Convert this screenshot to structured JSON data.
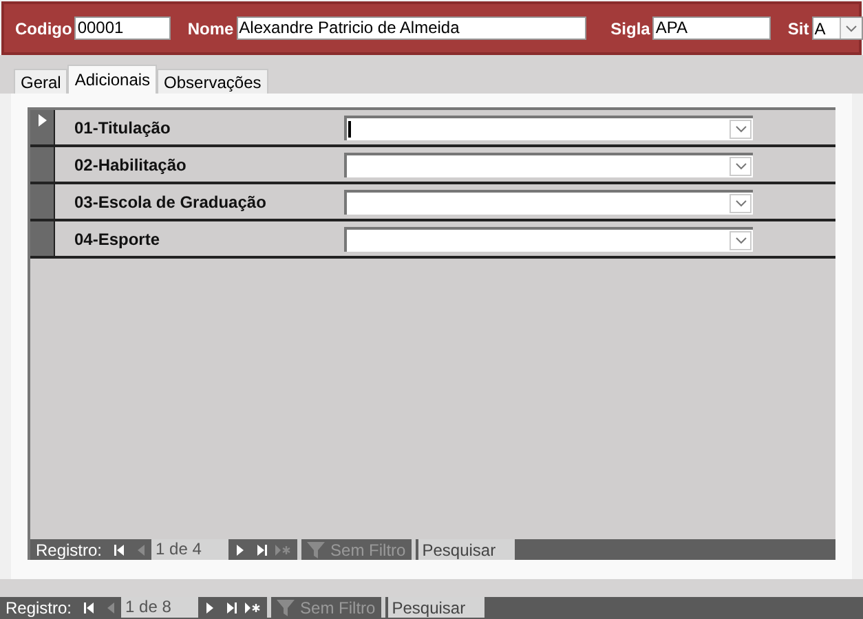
{
  "header": {
    "fields": [
      {
        "kind": "text",
        "label": "Codigo",
        "value": "00001"
      },
      {
        "kind": "text",
        "label": "Nome",
        "value": "Alexandre Patricio de Almeida"
      },
      {
        "kind": "text",
        "label": "Sigla",
        "value": "APA"
      },
      {
        "kind": "combo",
        "label": "Sit",
        "value": "A"
      }
    ]
  },
  "tabs": [
    {
      "label": "Geral",
      "selected": false
    },
    {
      "label": "Adicionais",
      "selected": true
    },
    {
      "label": "Observações",
      "selected": false
    }
  ],
  "rows": [
    {
      "label": "01-Titulação",
      "selected": true
    },
    {
      "label": "02-Habilitação",
      "selected": false
    },
    {
      "label": "03-Escola de Graduação",
      "selected": false
    },
    {
      "label": "04-Esporte",
      "selected": false
    }
  ],
  "subform_nav": {
    "label": "Registro:",
    "position": "1 de 4",
    "prev_enabled": false,
    "new_enabled": false,
    "filter_label": "Sem Filtro",
    "search_placeholder": "Pesquisar"
  },
  "form_nav": {
    "label": "Registro:",
    "position": "1 de 8",
    "prev_enabled": false,
    "new_enabled": true,
    "filter_label": "Sem Filtro",
    "search_placeholder": "Pesquisar"
  }
}
